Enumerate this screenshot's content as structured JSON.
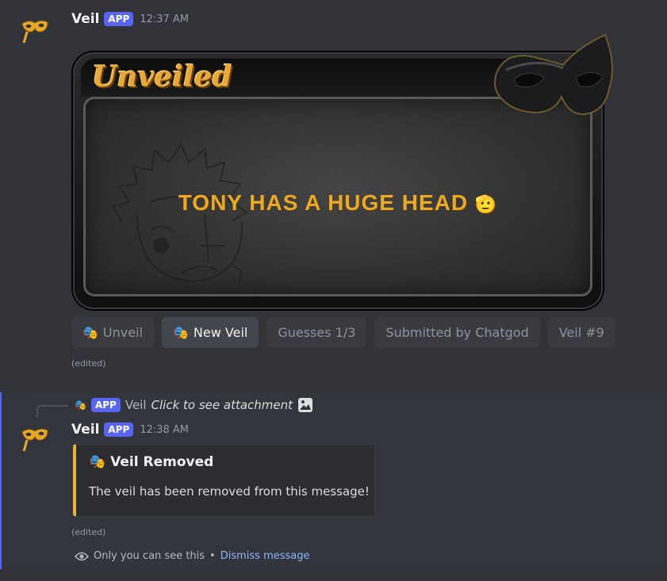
{
  "message1": {
    "author": "Veil",
    "badge": "APP",
    "timestamp": "12:37 AM",
    "card": {
      "title": "Unveiled",
      "reveal_text": "TONY HAS A HUGE HEAD",
      "reveal_emoji": "🫡"
    },
    "buttons": [
      {
        "label": "Unveil",
        "icon": "mask-icon"
      },
      {
        "label": "New Veil",
        "icon": "mask-icon"
      },
      {
        "label": "Guesses 1/3"
      },
      {
        "label": "Submitted by Chatgod"
      },
      {
        "label": "Veil #9"
      }
    ],
    "edited": "(edited)"
  },
  "message2": {
    "reply": {
      "badge": "APP",
      "author": "Veil",
      "text": "Click to see attachment"
    },
    "author": "Veil",
    "badge": "APP",
    "timestamp": "12:38 AM",
    "embed": {
      "title": "Veil Removed",
      "description": "The veil has been removed from this message!",
      "accent_color": "#f0b232"
    },
    "edited": "(edited)",
    "ephemeral": {
      "notice": "Only you can see this",
      "separator": "•",
      "dismiss_label": "Dismiss message"
    }
  },
  "colors": {
    "background": "#313338",
    "badge": "#5865f2",
    "highlight_border": "#5865f2",
    "gold": "#e9a92b"
  }
}
